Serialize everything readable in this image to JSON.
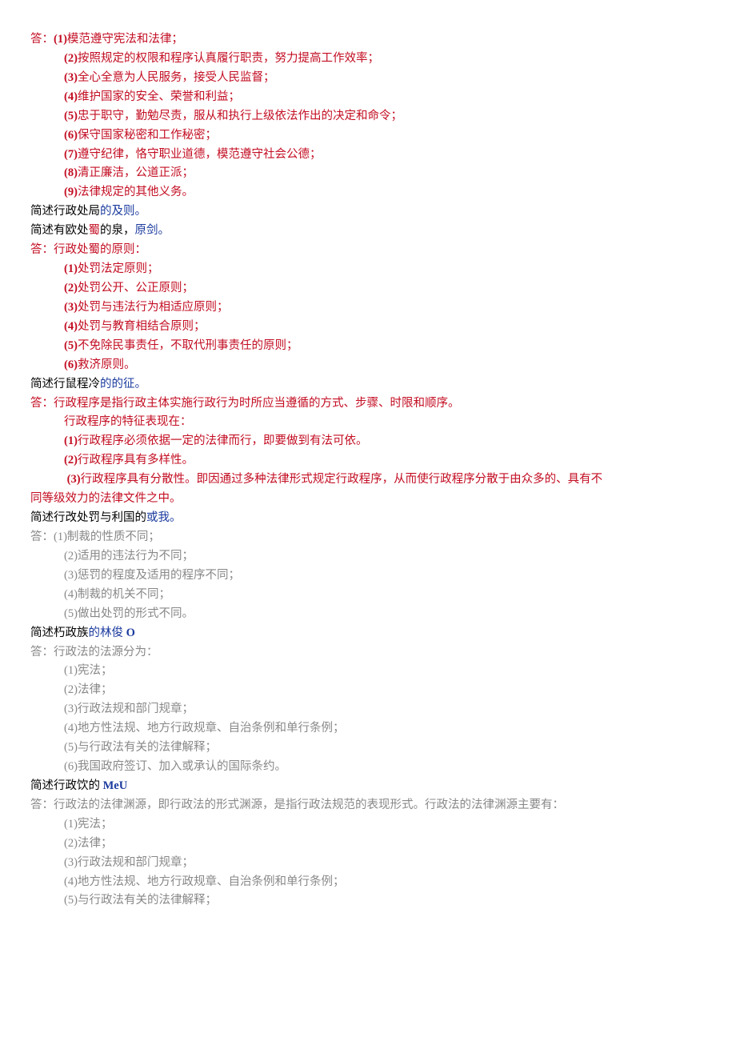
{
  "q1": {
    "prefix": "答：",
    "items": [
      {
        "n": "(1)",
        "t": "模范遵守宪法和法律；"
      },
      {
        "n": "(2)",
        "t": "按照规定的权限和程序认真履行职责，努力提高工作效率；"
      },
      {
        "n": "(3)",
        "t": "全心全意为人民服务，接受人民监督；"
      },
      {
        "n": "(4)",
        "t": "维护国家的安全、荣誉和利益；"
      },
      {
        "n": "(5)",
        "t": "忠于职守，勤勉尽责，服从和执行上级依法作出的决定和命令；"
      },
      {
        "n": "(6)",
        "t": "保守国家秘密和工作秘密；"
      },
      {
        "n": "(7)",
        "t": "遵守纪律，恪守职业道德，模范遵守社会公德；"
      },
      {
        "n": "(8)",
        "t": "清正廉洁，公道正派；"
      },
      {
        "n": "(9)",
        "t": "法律规定的其他义务。"
      }
    ]
  },
  "q2a": {
    "black": "简述行政处局",
    "blue": "的及则。"
  },
  "q2b": {
    "black": "简述有欧处",
    "red": "蜀",
    "black2": "的泉，",
    "blue": "原剑。"
  },
  "q2": {
    "prefix": "答：",
    "lead": "行政处蜀的原则：",
    "items": [
      {
        "n": "(1)",
        "t": "处罚法定原则；"
      },
      {
        "n": "(2)",
        "t": "处罚公开、公正原则；"
      },
      {
        "n": "(3)",
        "t": "处罚与违法行为相适应原则；"
      },
      {
        "n": "(4)",
        "t": "处罚与教育相结合原则；"
      },
      {
        "n": "(5)",
        "t": "不免除民事责任，不取代刑事责任的原则；"
      },
      {
        "n": "(6)",
        "t": "救济原则。"
      }
    ]
  },
  "q3title": {
    "black": "简述行鼠程冷",
    "blue": "的的征。"
  },
  "q3": {
    "prefix": "答：",
    "lead1": "行政程序是指行政主体实施行政行为时所应当遵循的方式、步骤、时限和顺序。",
    "lead2": "行政程序的特征表现在：",
    "items": [
      {
        "n": "(1)",
        "t": "行政程序必须依据一定的法律而行，即要做到有法可依。"
      },
      {
        "n": "(2)",
        "t": "行政程序具有多样性。"
      }
    ],
    "item3n": " (3)",
    "item3t": "行政程序具有分散性。即因通过多种法律形式规定行政程序，从而使行政程序分散于由众多的、具有不",
    "item3cont": "同等级效力的法律文件之中。"
  },
  "q4title": {
    "black": "简述行改处罚与利国的",
    "blue": "或我。"
  },
  "q4": {
    "prefix": "答：",
    "items": [
      {
        "n": "(1)",
        "t": "制裁的性质不同；"
      },
      {
        "n": "(2)",
        "t": "适用的违法行为不同；"
      },
      {
        "n": "(3)",
        "t": "惩罚的程度及适用的程序不同；"
      },
      {
        "n": "(4)",
        "t": "制裁的机关不同；"
      },
      {
        "n": "(5)",
        "t": "做出处罚的形式不同。"
      }
    ]
  },
  "q5title": {
    "black1": "简述朽政族",
    "blue1": "的林俊 ",
    "bold": "O"
  },
  "q5": {
    "prefix": "答：",
    "lead": "行政法的法源分为：",
    "items": [
      {
        "n": "(1)",
        "t": "宪法；"
      },
      {
        "n": "(2)",
        "t": "法律；"
      },
      {
        "n": "(3)",
        "t": "行政法规和部门规章；"
      },
      {
        "n": "(4)",
        "t": "地方性法规、地方行政规章、自治条例和单行条例；"
      },
      {
        "n": "(5)",
        "t": "与行政法有关的法律解释；"
      },
      {
        "n": "(6)",
        "t": "我国政府签订、加入或承认的国际条约。"
      }
    ]
  },
  "q6title": {
    "black": "简述行政饮的 ",
    "bold": "MeU"
  },
  "q6": {
    "prefix": "答：",
    "lead": "行政法的法律渊源，即行政法的形式渊源，是指行政法规范的表现形式。行政法的法律渊源主要有：",
    "items": [
      {
        "n": "(1)",
        "t": "宪法；"
      },
      {
        "n": "(2)",
        "t": "法律；"
      },
      {
        "n": "(3)",
        "t": "行政法规和部门规章；"
      },
      {
        "n": "(4)",
        "t": "地方性法规、地方行政规章、自治条例和单行条例；"
      },
      {
        "n": "(5)",
        "t": "与行政法有关的法律解释；"
      }
    ]
  }
}
